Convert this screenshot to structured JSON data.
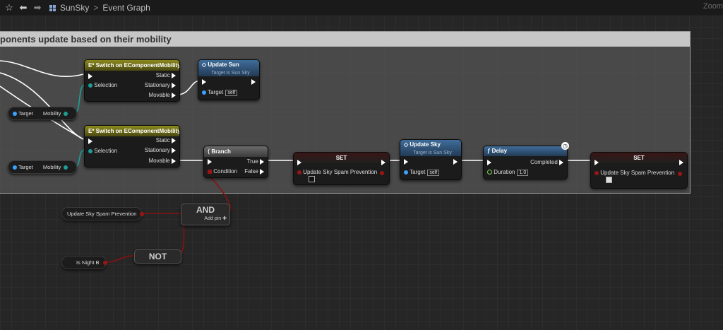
{
  "toolbar": {
    "breadcrumb_root": "SunSky",
    "breadcrumb_sep": ">",
    "breadcrumb_current": "Event Graph",
    "zoom_label": "Zoom"
  },
  "comment": {
    "title": "ponents update based on their mobility"
  },
  "nodes": {
    "switch1": {
      "title": "E* Switch on EComponentMobility",
      "selection": "Selection",
      "static": "Static",
      "stationary": "Stationary",
      "movable": "Movable"
    },
    "switch2": {
      "title": "E* Switch on EComponentMobility",
      "selection": "Selection",
      "static": "Static",
      "stationary": "Stationary",
      "movable": "Movable"
    },
    "update_sun": {
      "title": "Update Sun",
      "subtitle": "Target is Sun Sky",
      "target": "Target",
      "target_value": "self"
    },
    "branch": {
      "title": "Branch",
      "condition": "Condition",
      "true": "True",
      "false": "False"
    },
    "set1": {
      "title": "SET",
      "var": "Update Sky Spam Prevention",
      "checked": false
    },
    "update_sky": {
      "title": "Update Sky",
      "subtitle": "Target is Sun Sky",
      "target": "Target",
      "target_value": "self"
    },
    "delay": {
      "title": "Delay",
      "completed": "Completed",
      "duration": "Duration",
      "duration_value": "1.0"
    },
    "set2": {
      "title": "SET",
      "var": "Update Sky Spam Prevention",
      "checked": true
    }
  },
  "getters": {
    "mobility1": {
      "target": "Target",
      "label": "Mobility"
    },
    "mobility2": {
      "target": "Target",
      "label": "Mobility"
    },
    "spam_var": "Update Sky Spam Prevention",
    "is_night": "Is Night B"
  },
  "ops": {
    "and": "AND",
    "and_add_pin": "Add pin",
    "not": "NOT"
  },
  "colors": {
    "graph_bg": "#262626",
    "comment_bg": "#585858",
    "exec_wire": "#ffffff",
    "bool_wire": "#8b1111",
    "enum_wire": "#1e9e96"
  }
}
